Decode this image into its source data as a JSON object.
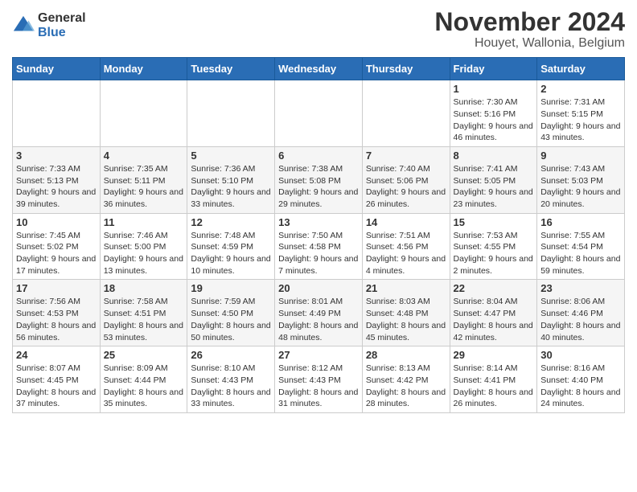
{
  "logo": {
    "line1": "General",
    "line2": "Blue"
  },
  "title": "November 2024",
  "location": "Houyet, Wallonia, Belgium",
  "days_of_week": [
    "Sunday",
    "Monday",
    "Tuesday",
    "Wednesday",
    "Thursday",
    "Friday",
    "Saturday"
  ],
  "weeks": [
    [
      {
        "day": "",
        "info": ""
      },
      {
        "day": "",
        "info": ""
      },
      {
        "day": "",
        "info": ""
      },
      {
        "day": "",
        "info": ""
      },
      {
        "day": "",
        "info": ""
      },
      {
        "day": "1",
        "info": "Sunrise: 7:30 AM\nSunset: 5:16 PM\nDaylight: 9 hours and 46 minutes."
      },
      {
        "day": "2",
        "info": "Sunrise: 7:31 AM\nSunset: 5:15 PM\nDaylight: 9 hours and 43 minutes."
      }
    ],
    [
      {
        "day": "3",
        "info": "Sunrise: 7:33 AM\nSunset: 5:13 PM\nDaylight: 9 hours and 39 minutes."
      },
      {
        "day": "4",
        "info": "Sunrise: 7:35 AM\nSunset: 5:11 PM\nDaylight: 9 hours and 36 minutes."
      },
      {
        "day": "5",
        "info": "Sunrise: 7:36 AM\nSunset: 5:10 PM\nDaylight: 9 hours and 33 minutes."
      },
      {
        "day": "6",
        "info": "Sunrise: 7:38 AM\nSunset: 5:08 PM\nDaylight: 9 hours and 29 minutes."
      },
      {
        "day": "7",
        "info": "Sunrise: 7:40 AM\nSunset: 5:06 PM\nDaylight: 9 hours and 26 minutes."
      },
      {
        "day": "8",
        "info": "Sunrise: 7:41 AM\nSunset: 5:05 PM\nDaylight: 9 hours and 23 minutes."
      },
      {
        "day": "9",
        "info": "Sunrise: 7:43 AM\nSunset: 5:03 PM\nDaylight: 9 hours and 20 minutes."
      }
    ],
    [
      {
        "day": "10",
        "info": "Sunrise: 7:45 AM\nSunset: 5:02 PM\nDaylight: 9 hours and 17 minutes."
      },
      {
        "day": "11",
        "info": "Sunrise: 7:46 AM\nSunset: 5:00 PM\nDaylight: 9 hours and 13 minutes."
      },
      {
        "day": "12",
        "info": "Sunrise: 7:48 AM\nSunset: 4:59 PM\nDaylight: 9 hours and 10 minutes."
      },
      {
        "day": "13",
        "info": "Sunrise: 7:50 AM\nSunset: 4:58 PM\nDaylight: 9 hours and 7 minutes."
      },
      {
        "day": "14",
        "info": "Sunrise: 7:51 AM\nSunset: 4:56 PM\nDaylight: 9 hours and 4 minutes."
      },
      {
        "day": "15",
        "info": "Sunrise: 7:53 AM\nSunset: 4:55 PM\nDaylight: 9 hours and 2 minutes."
      },
      {
        "day": "16",
        "info": "Sunrise: 7:55 AM\nSunset: 4:54 PM\nDaylight: 8 hours and 59 minutes."
      }
    ],
    [
      {
        "day": "17",
        "info": "Sunrise: 7:56 AM\nSunset: 4:53 PM\nDaylight: 8 hours and 56 minutes."
      },
      {
        "day": "18",
        "info": "Sunrise: 7:58 AM\nSunset: 4:51 PM\nDaylight: 8 hours and 53 minutes."
      },
      {
        "day": "19",
        "info": "Sunrise: 7:59 AM\nSunset: 4:50 PM\nDaylight: 8 hours and 50 minutes."
      },
      {
        "day": "20",
        "info": "Sunrise: 8:01 AM\nSunset: 4:49 PM\nDaylight: 8 hours and 48 minutes."
      },
      {
        "day": "21",
        "info": "Sunrise: 8:03 AM\nSunset: 4:48 PM\nDaylight: 8 hours and 45 minutes."
      },
      {
        "day": "22",
        "info": "Sunrise: 8:04 AM\nSunset: 4:47 PM\nDaylight: 8 hours and 42 minutes."
      },
      {
        "day": "23",
        "info": "Sunrise: 8:06 AM\nSunset: 4:46 PM\nDaylight: 8 hours and 40 minutes."
      }
    ],
    [
      {
        "day": "24",
        "info": "Sunrise: 8:07 AM\nSunset: 4:45 PM\nDaylight: 8 hours and 37 minutes."
      },
      {
        "day": "25",
        "info": "Sunrise: 8:09 AM\nSunset: 4:44 PM\nDaylight: 8 hours and 35 minutes."
      },
      {
        "day": "26",
        "info": "Sunrise: 8:10 AM\nSunset: 4:43 PM\nDaylight: 8 hours and 33 minutes."
      },
      {
        "day": "27",
        "info": "Sunrise: 8:12 AM\nSunset: 4:43 PM\nDaylight: 8 hours and 31 minutes."
      },
      {
        "day": "28",
        "info": "Sunrise: 8:13 AM\nSunset: 4:42 PM\nDaylight: 8 hours and 28 minutes."
      },
      {
        "day": "29",
        "info": "Sunrise: 8:14 AM\nSunset: 4:41 PM\nDaylight: 8 hours and 26 minutes."
      },
      {
        "day": "30",
        "info": "Sunrise: 8:16 AM\nSunset: 4:40 PM\nDaylight: 8 hours and 24 minutes."
      }
    ]
  ]
}
